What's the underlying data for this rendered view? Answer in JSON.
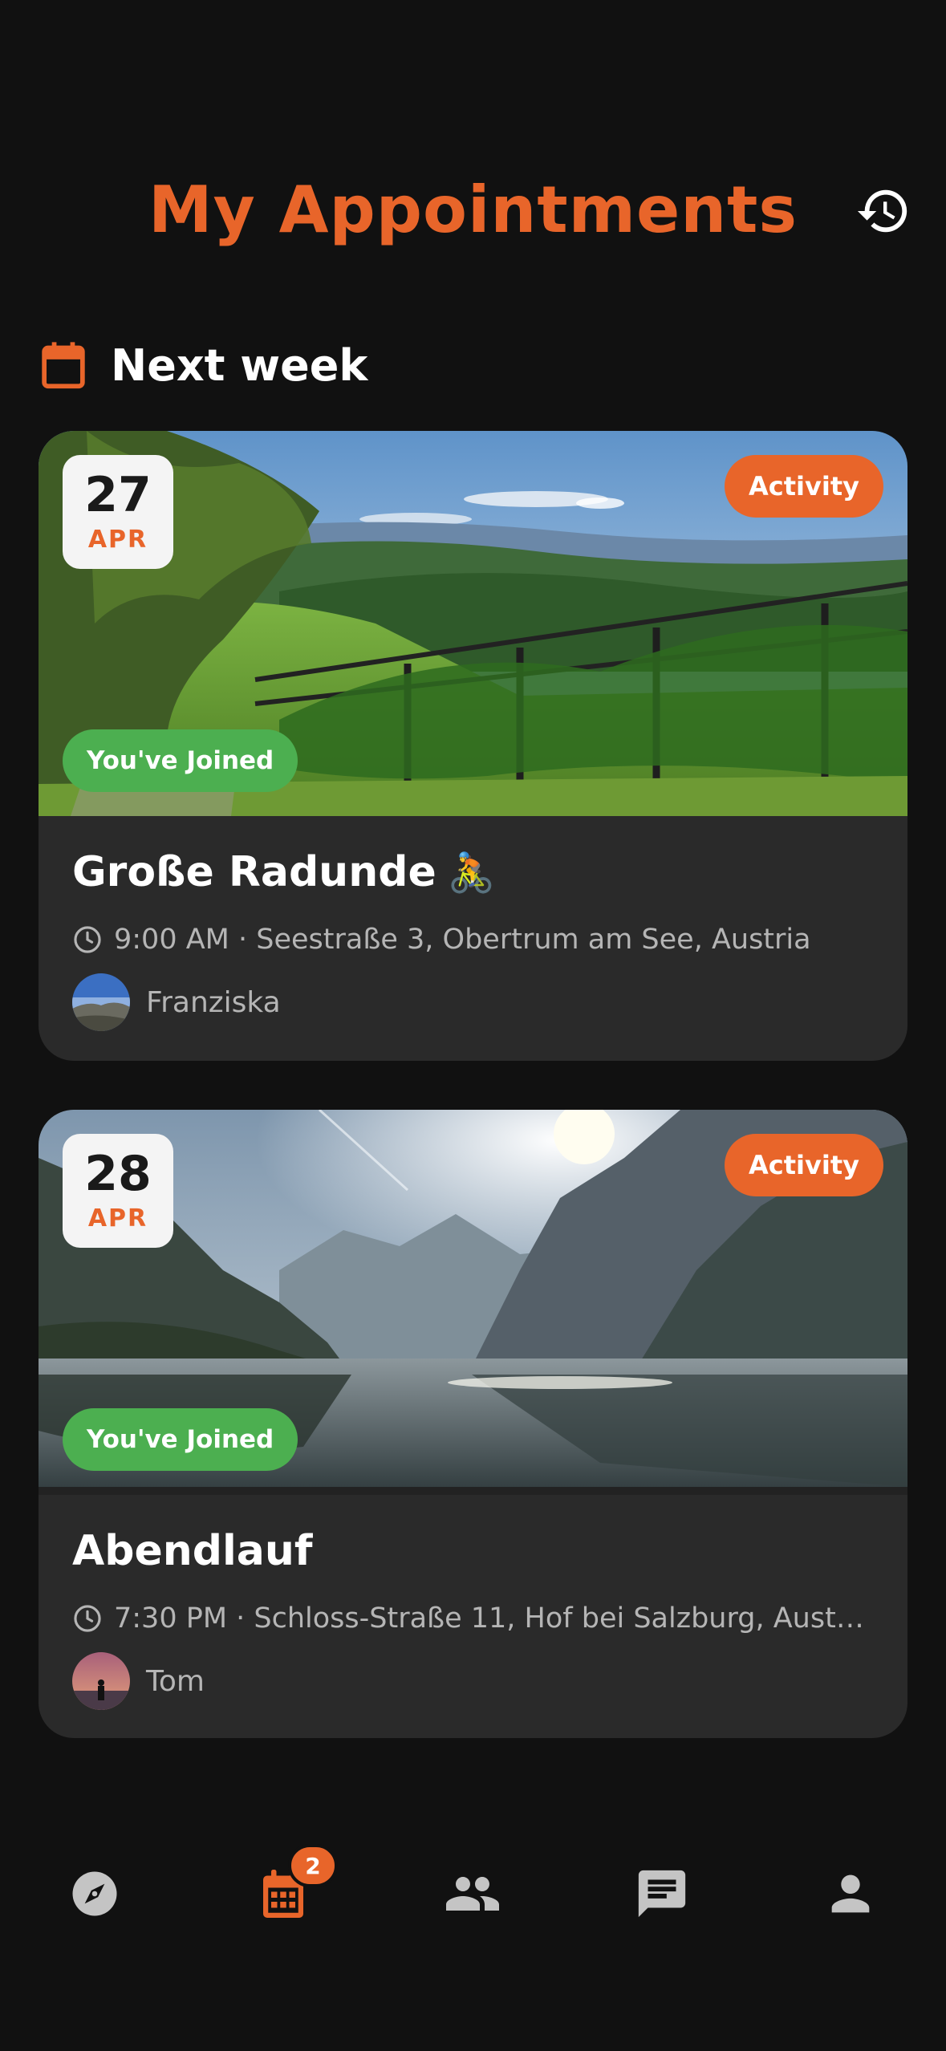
{
  "header": {
    "title": "My Appointments",
    "history_icon": "history-icon"
  },
  "section": {
    "title": "Next week",
    "icon": "calendar-icon"
  },
  "appointments": [
    {
      "day": "27",
      "month": "APR",
      "type": "Activity",
      "status": "You've Joined",
      "title": "Große Radunde",
      "emoji": "🚴",
      "time_location": "9:00 AM · Seestraße 3, Obertrum am See, Austria",
      "host": "Franziska"
    },
    {
      "day": "28",
      "month": "APR",
      "type": "Activity",
      "status": "You've Joined",
      "title": "Abendlauf",
      "time_location": "7:30 PM · Schloss-Straße 11, Hof bei Salzburg, Aust…",
      "host": "Tom"
    }
  ],
  "nav": {
    "items": [
      "compass-icon",
      "calendar-icon",
      "people-icon",
      "chat-icon",
      "person-icon"
    ],
    "active": "calendar-icon",
    "badge": "2"
  },
  "colors": {
    "accent": "#E8652A",
    "joined": "#4CAF50",
    "card": "#2a2a2a",
    "background": "#111111"
  }
}
